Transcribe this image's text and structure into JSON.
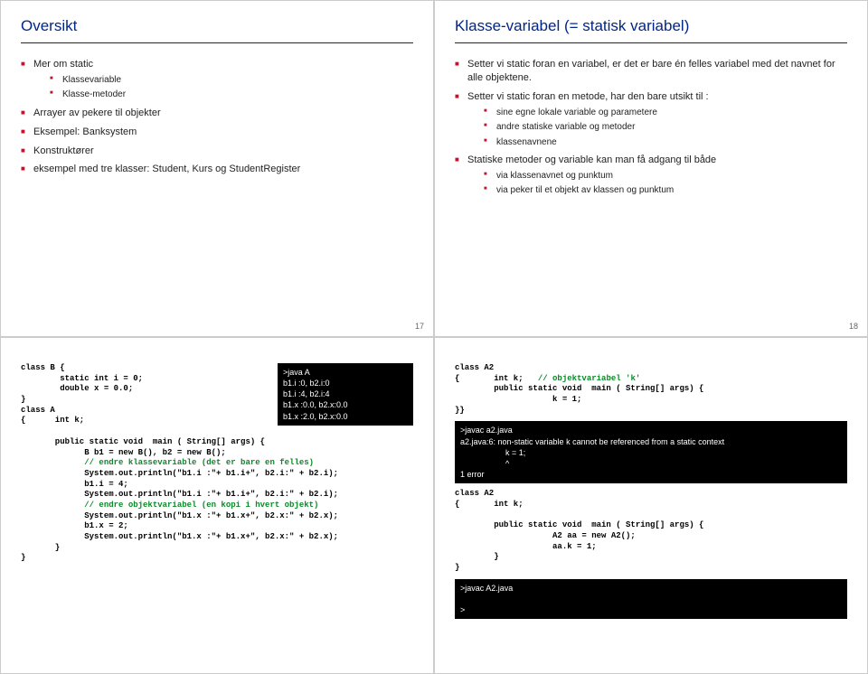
{
  "slide1": {
    "title": "Oversikt",
    "items": [
      {
        "text": "Mer om static",
        "sub": [
          {
            "text": "Klassevariable"
          },
          {
            "text": "Klasse-metoder"
          }
        ]
      },
      {
        "text": "Arrayer av pekere til objekter"
      },
      {
        "text": "Eksempel: Banksystem"
      },
      {
        "text": "Konstruktører"
      },
      {
        "text": "eksempel med tre klasser: Student, Kurs og StudentRegister"
      }
    ],
    "num": "17"
  },
  "slide2": {
    "title": "Klasse-variabel (= statisk variabel)",
    "items": [
      {
        "text": "Setter vi static foran en variabel, er det er bare én felles variabel med det navnet for alle objektene."
      },
      {
        "text": "Setter vi static foran en metode, har den bare utsikt til :",
        "sub": [
          {
            "text": "sine egne lokale variable og parametere"
          },
          {
            "text": "andre statiske variable og metoder"
          },
          {
            "text": "klassenavnene"
          }
        ]
      },
      {
        "text": "Statiske metoder og variable kan man få adgang til både",
        "sub": [
          {
            "text": "via klassenavnet og punktum"
          },
          {
            "text": "via peker til et objekt av klassen og punktum"
          }
        ]
      }
    ],
    "num": "18"
  },
  "slide3": {
    "code1": "class B {\n        static int i = 0;\n        double x = 0.0;\n}\nclass A\n{      int k;\n\n",
    "code2_pre": "       public static void  main ( String[] args) {\n             B b1 = new B(), b2 = new B();\n",
    "code2_comment": "             // endre klassevariable (det er bare en felles)\n",
    "code2_mid": "             System.out.println(\"b1.i :\"+ b1.i+\", b2.i:\" + b2.i);\n             b1.i = 4;\n             System.out.println(\"b1.i :\"+ b1.i+\", b2.i:\" + b2.i);\n",
    "code2_comment2": "             // endre objektvariabel (en kopi i hvert objekt)\n",
    "code2_end": "             System.out.println(\"b1.x :\"+ b1.x+\", b2.x:\" + b2.x);\n             b1.x = 2;\n             System.out.println(\"b1.x :\"+ b1.x+\", b2.x:\" + b2.x);\n       }\n}",
    "term": ">java A\nb1.i :0, b2.i:0\nb1.i :4, b2.i:4\nb1.x :0.0, b2.x:0.0\nb1.x :2.0, b2.x:0.0"
  },
  "slide4": {
    "code1_a": "class A2\n{       int k;   ",
    "code1_comment": "// objektvariabel 'k'",
    "code1_b": "\n        public static void  main ( String[] args) {\n                    k = 1;\n}}",
    "term1": ">javac a2.java\na2.java:6: non-static variable k cannot be referenced from a static context\n                    k = 1;\n                    ^\n1 error",
    "code2": "class A2\n{       int k;\n\n        public static void  main ( String[] args) {\n                    A2 aa = new A2();\n                    aa.k = 1;\n        }\n}",
    "term2": ">javac A2.java\n\n>"
  }
}
